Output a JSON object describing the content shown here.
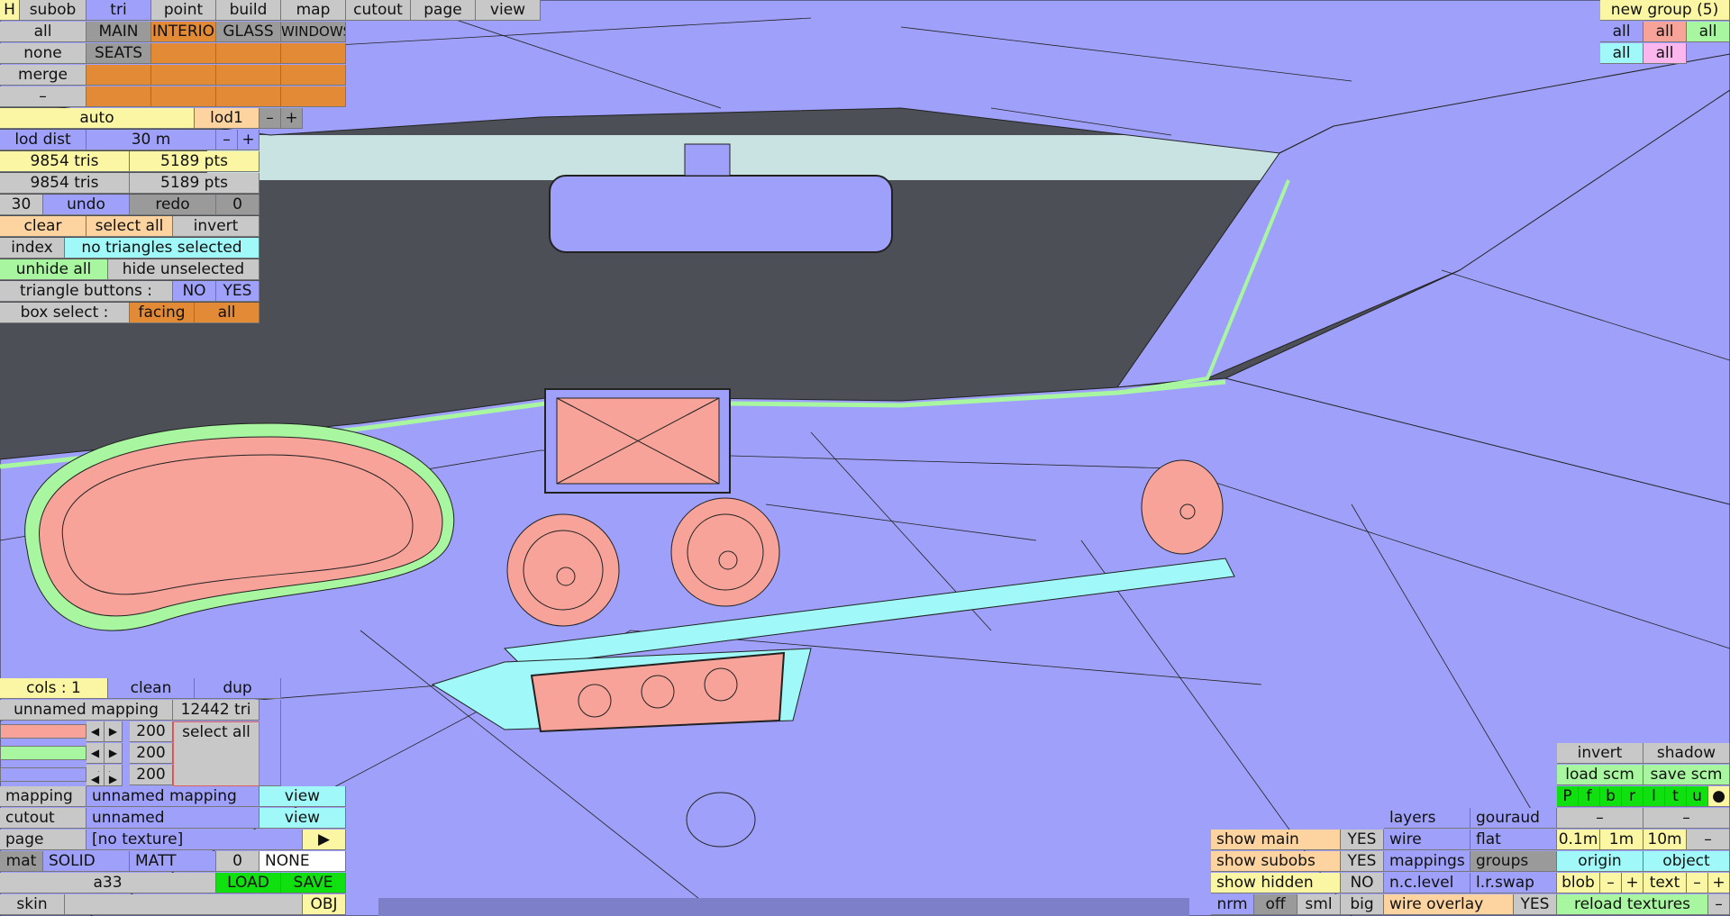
{
  "toolbar": {
    "h": "H",
    "tabs": [
      "subob",
      "tri",
      "point",
      "build",
      "map",
      "cutout",
      "page",
      "view"
    ]
  },
  "select": {
    "all": "all",
    "none": "none",
    "merge": "merge",
    "minus": "–"
  },
  "groups": {
    "main": "MAIN",
    "interio": "INTERIO",
    "glass": "GLASS",
    "windows": "WINDOWS",
    "seats": "SEATS"
  },
  "lod": {
    "auto": "auto",
    "level": "lod1",
    "minus": "–",
    "plus": "+",
    "dist_label": "lod dist",
    "dist_value": "30 m"
  },
  "counts": {
    "tris1": "9854 tris",
    "pts1": "5189 pts",
    "tris2": "9854 tris",
    "pts2": "5189 pts"
  },
  "undo": {
    "count_left": "30",
    "undo": "undo",
    "redo": "redo",
    "count_right": "0"
  },
  "actions": {
    "clear": "clear",
    "select_all": "select all",
    "invert": "invert",
    "index": "index",
    "status": "no triangles selected",
    "unhide_all": "unhide all",
    "hide_unselected": "hide unselected"
  },
  "triangle_buttons": {
    "label": "triangle buttons :",
    "no": "NO",
    "yes": "YES"
  },
  "box_select": {
    "label": "box select :",
    "facing": "facing",
    "all": "all"
  },
  "new_group": {
    "title": "new group (5)",
    "all": "all"
  },
  "mapping": {
    "cols": "cols : 1",
    "clean": "clean",
    "dup": "dup",
    "name": "unnamed mapping",
    "tri_count": "12442 tri",
    "rgb": [
      "200",
      "200",
      "200"
    ],
    "select_all": "select all",
    "mapping_label": "mapping",
    "mapping_value": "unnamed mapping",
    "view": "view",
    "cutout_label": "cutout",
    "cutout_value": "unnamed",
    "page_label": "page",
    "page_value": "[no texture]",
    "play": "▶",
    "mat": "mat",
    "solid": "SOLID",
    "matt": "MATT",
    "zero": "0",
    "none": "NONE",
    "model": "a33",
    "load": "LOAD",
    "save": "SAVE",
    "skin": "skin",
    "obj": "OBJ"
  },
  "display": {
    "show_main": "show main",
    "show_main_v": "YES",
    "show_subobs": "show subobs",
    "show_subobs_v": "YES",
    "show_hidden": "show hidden",
    "show_hidden_v": "NO",
    "nrm": "nrm",
    "off": "off",
    "sml": "sml",
    "big": "big",
    "wire_overlay": "wire overlay",
    "wire_overlay_v": "YES",
    "layers": "layers",
    "gouraud": "gouraud",
    "wire": "wire",
    "flat": "flat",
    "mappings": "mappings",
    "groups": "groups",
    "nclevel": "n.c.level",
    "lrswap": "l.r.swap"
  },
  "right": {
    "invert": "invert",
    "shadow": "shadow",
    "load_scm": "load scm",
    "save_scm": "save scm",
    "views": [
      "P",
      "f",
      "b",
      "r",
      "l",
      "t",
      "u",
      "●"
    ],
    "dash": "–",
    "grid": [
      "0.1m",
      "1m",
      "10m",
      "–"
    ],
    "origin": "origin",
    "object": "object",
    "blob": "blob",
    "text": "text",
    "minus": "–",
    "plus": "+",
    "reload": "reload textures"
  },
  "colors": {
    "mesh": "#9ea0fa",
    "red": "#f7a399",
    "green": "#a8f7a0",
    "cyan": "#a0f8f8",
    "orange": "#e28a35",
    "yellow": "#fbf6a4",
    "sky": "#c9e3e3",
    "void": "#4c4f55"
  }
}
